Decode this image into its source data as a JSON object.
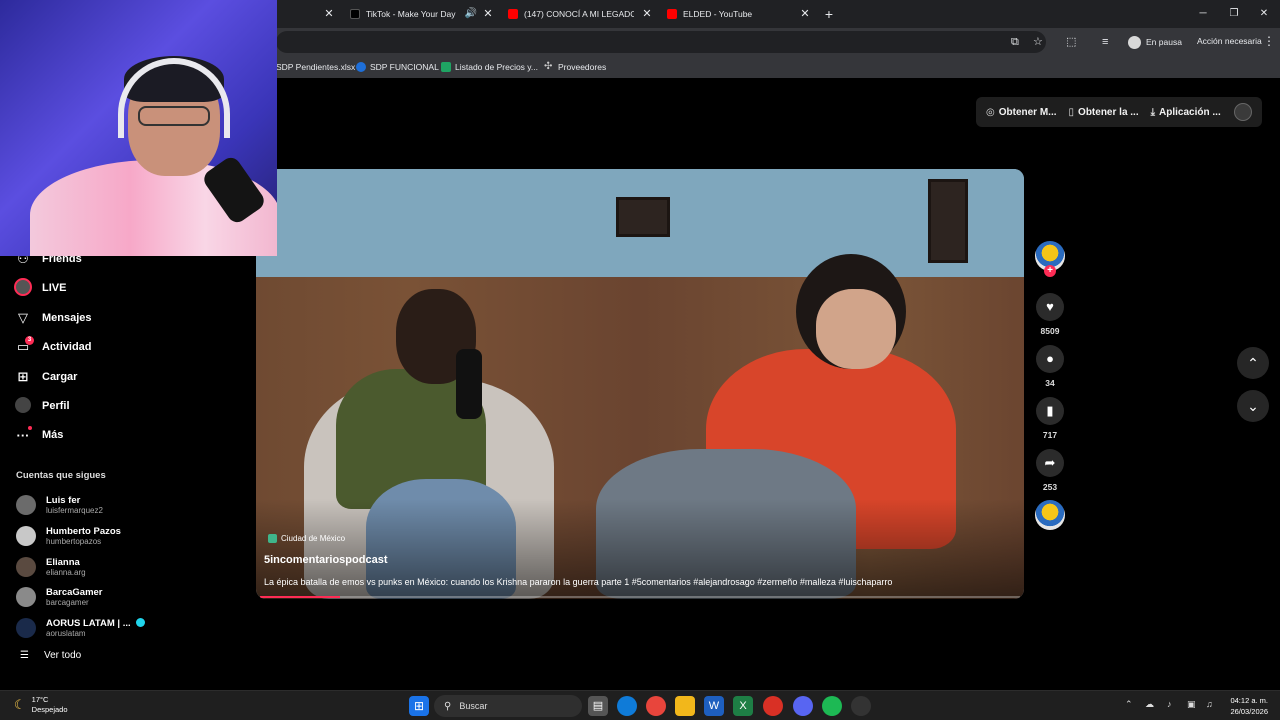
{
  "browser": {
    "tabs": [
      {
        "title": "TikTok - Make Your Day",
        "icon": "tiktok-icon"
      },
      {
        "title": "(147) CONOCÍ A MI LEGADO - ",
        "icon": "youtube-icon"
      },
      {
        "title": "ELDED - YouTube",
        "icon": "youtube-icon"
      }
    ],
    "new_tab": "+",
    "profile_status": "En pausa",
    "action_needed": "Acción necesaria",
    "bookmarks": [
      "SDP Pendientes.xlsx",
      "SDP FUNCIONAL",
      "Listado de Precios y...",
      "Proveedores"
    ]
  },
  "top_actions": [
    "Obtener M...",
    "Obtener la ...",
    "Aplicación ..."
  ],
  "sidebar": {
    "nav": [
      {
        "label": "Friends",
        "icon": "friends-icon"
      },
      {
        "label": "LIVE",
        "icon": "live-icon"
      },
      {
        "label": "Mensajes",
        "icon": "messages-icon"
      },
      {
        "label": "Actividad",
        "icon": "activity-icon",
        "badge": "3"
      },
      {
        "label": "Cargar",
        "icon": "upload-icon"
      },
      {
        "label": "Perfil",
        "icon": "profile-icon"
      },
      {
        "label": "Más",
        "icon": "more-icon"
      }
    ],
    "following_title": "Cuentas que sigues",
    "following": [
      {
        "name": "Luis fer",
        "user": "luisfermarquez2"
      },
      {
        "name": "Humberto Pazos",
        "user": "humbertopazos"
      },
      {
        "name": "Elianna",
        "user": "elianna.arg"
      },
      {
        "name": "BarcaGamer",
        "user": "barcagamer"
      },
      {
        "name": "AORUS LATAM | ...",
        "user": "aoruslatam",
        "verified": true
      }
    ],
    "see_all": "Ver todo"
  },
  "video": {
    "location": "Ciudad de México",
    "author": "5incomentariospodcast",
    "description": "La épica batalla de emos vs punks en México: cuando los Krishna pararon la guerra parte 1 #5comentarios #alejandrosago #zermeño #malleza #luischaparro",
    "progress_percent": 10.5
  },
  "actions": {
    "likes": "8509",
    "comments": "34",
    "saves": "717",
    "shares": "253"
  },
  "taskbar": {
    "temperature": "17°C",
    "weather": "Despejado",
    "search_placeholder": "Buscar",
    "time": "04:12 a. m.",
    "date": "26/03/2026"
  },
  "colors": {
    "accent": "#fe2c55",
    "background": "#000000"
  }
}
